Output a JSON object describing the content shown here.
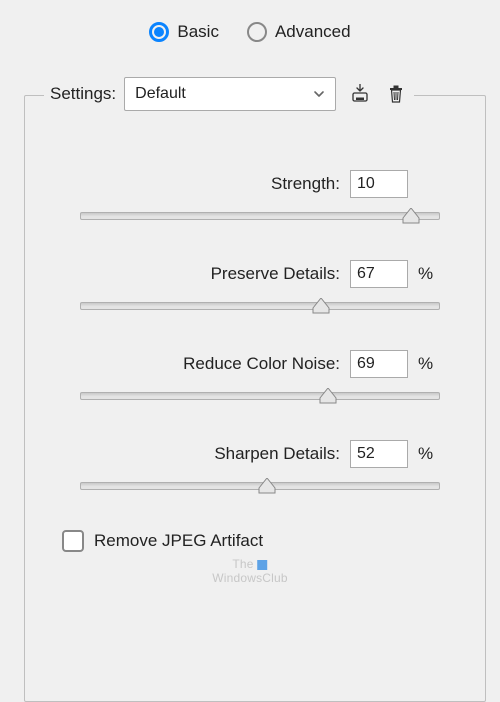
{
  "mode": {
    "basic_label": "Basic",
    "advanced_label": "Advanced",
    "selected": "basic"
  },
  "settings": {
    "label": "Settings:",
    "value": "Default"
  },
  "sliders": {
    "strength": {
      "label": "Strength:",
      "value": "10",
      "unit": "",
      "pct": 92
    },
    "preserve_details": {
      "label": "Preserve Details:",
      "value": "67",
      "unit": "%",
      "pct": 67
    },
    "reduce_color_noise": {
      "label": "Reduce Color Noise:",
      "value": "69",
      "unit": "%",
      "pct": 69
    },
    "sharpen_details": {
      "label": "Sharpen Details:",
      "value": "52",
      "unit": "%",
      "pct": 52
    }
  },
  "checkbox": {
    "remove_jpeg_label": "Remove JPEG Artifact",
    "checked": false
  },
  "watermark": {
    "line1": "The",
    "line2": "WindowsClub"
  }
}
